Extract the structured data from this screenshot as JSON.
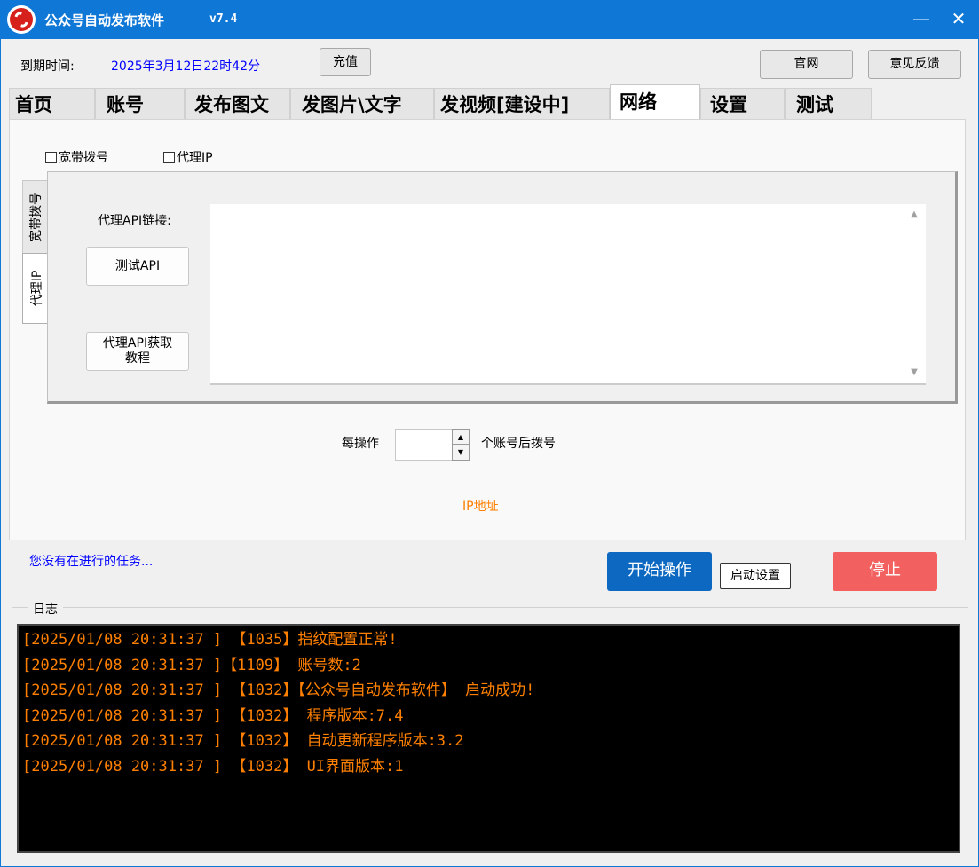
{
  "window": {
    "title": "公众号自动发布软件",
    "version": "v7.4",
    "minimize_glyph": "—",
    "close_glyph": "✕",
    "colors": {
      "titlebar": "#0f78d7",
      "accent_link": "#0000ff",
      "log_text": "#ff8000",
      "start_button": "#0c68c0",
      "stop_button": "#f36060"
    }
  },
  "header": {
    "expire_label": "到期时间:",
    "expire_value": "2025年3月12日22时42分",
    "recharge_label": "充值",
    "website_label": "官网",
    "feedback_label": "意见反馈"
  },
  "tabs": [
    {
      "label": "首页",
      "active": false
    },
    {
      "label": "账号",
      "active": false
    },
    {
      "label": "发布图文",
      "active": false
    },
    {
      "label": "发图片\\文字",
      "active": false
    },
    {
      "label": "发视频[建设中]",
      "active": false
    },
    {
      "label": "网络",
      "active": true
    },
    {
      "label": "设置",
      "active": false
    },
    {
      "label": "测试",
      "active": false
    }
  ],
  "network": {
    "broadband_checkbox_label": "宽带拨号",
    "broadband_checked": false,
    "proxy_checkbox_label": "代理IP",
    "proxy_checked": false,
    "side_tabs": [
      {
        "label": "宽带拨号",
        "active": false
      },
      {
        "label": "代理IP",
        "active": true
      }
    ],
    "proxy_api_label": "代理API链接:",
    "proxy_api_value": "",
    "test_api_label": "测试API",
    "tutorial_label_line1": "代理API获取",
    "tutorial_label_line2": "教程",
    "per_op_label": "每操作",
    "per_op_value": "",
    "per_op_suffix": "个账号后拨号",
    "ip_address_label": "IP地址"
  },
  "status": {
    "task_status": "您没有在进行的任务...",
    "start_label": "开始操作",
    "startup_settings_label": "启动设置",
    "stop_label": "停止"
  },
  "log": {
    "title": "日志",
    "lines": [
      "[2025/01/08 20:31:37 ] 【1035】指纹配置正常!",
      "[2025/01/08 20:31:37 ]【1109】 账号数:2",
      "[2025/01/08 20:31:37 ] 【1032】【公众号自动发布软件】 启动成功!",
      "[2025/01/08 20:31:37 ] 【1032】 程序版本:7.4",
      "[2025/01/08 20:31:37 ] 【1032】 自动更新程序版本:3.2",
      "[2025/01/08 20:31:37 ] 【1032】 UI界面版本:1"
    ]
  }
}
